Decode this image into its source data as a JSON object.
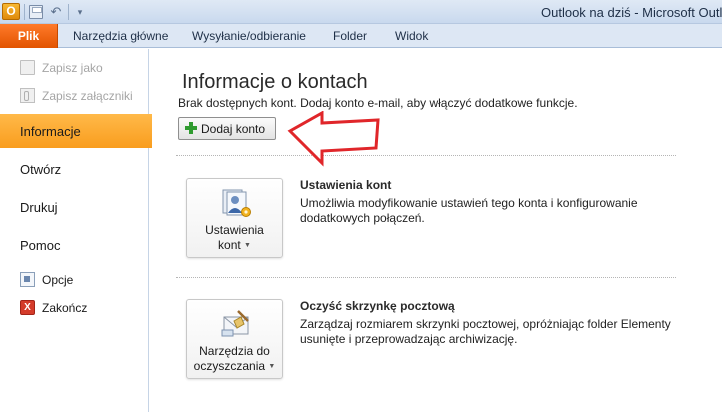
{
  "window": {
    "title": "Outlook na dziś - Microsoft Outlo",
    "app_icon_letter": "O"
  },
  "ribbon": {
    "file_tab": "Plik",
    "tabs": [
      "Narzędzia główne",
      "Wysyłanie/odbieranie",
      "Folder",
      "Widok"
    ]
  },
  "leftnav": {
    "save_as": "Zapisz jako",
    "save_attachments": "Zapisz załączniki",
    "info": "Informacje",
    "open": "Otwórz",
    "print": "Drukuj",
    "help": "Pomoc",
    "options": "Opcje",
    "exit": "Zakończ",
    "exit_icon_letter": "X"
  },
  "main": {
    "title": "Informacje o kontach",
    "no_accounts": "Brak dostępnych kont. Dodaj konto e-mail, aby włączyć dodatkowe funkcje.",
    "add_account": "Dodaj konto",
    "account_settings": {
      "button_line1": "Ustawienia",
      "button_line2": "kont",
      "title": "Ustawienia kont",
      "description": "Umożliwia modyfikowanie ustawień tego konta i konfigurowanie dodatkowych połączeń."
    },
    "cleanup": {
      "button_line1": "Narzędzia do",
      "button_line2": "oczyszczania",
      "title": "Oczyść skrzynkę pocztową",
      "description": "Zarządzaj rozmiarem skrzynki pocztowej, opróżniając folder Elementy usunięte i przeprowadzając archiwizację."
    }
  },
  "colors": {
    "file_tab": "#e25400",
    "active_nav": "#f99d1e",
    "annotation_arrow": "#e0262a",
    "add_icon": "#2f9b2f"
  }
}
